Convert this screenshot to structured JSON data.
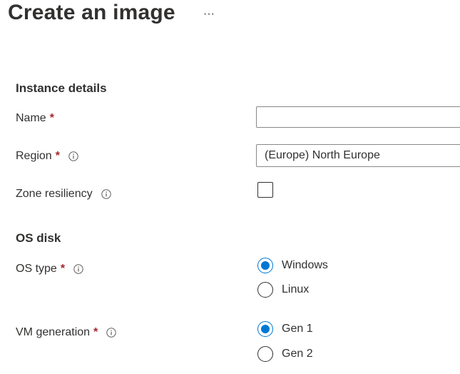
{
  "header": {
    "title": "Create an image",
    "more_label": "···"
  },
  "sections": {
    "instance_details": "Instance details",
    "os_disk": "OS disk"
  },
  "fields": {
    "name": {
      "label": "Name",
      "required": "*",
      "value": "",
      "placeholder": ""
    },
    "region": {
      "label": "Region",
      "required": "*",
      "value": "(Europe) North Europe"
    },
    "zone_resiliency": {
      "label": "Zone resiliency",
      "checked": false
    },
    "os_type": {
      "label": "OS type",
      "required": "*",
      "options": [
        "Windows",
        "Linux"
      ],
      "selected": "Windows"
    },
    "vm_generation": {
      "label": "VM generation",
      "required": "*",
      "options": [
        "Gen 1",
        "Gen 2"
      ],
      "selected": "Gen 1"
    }
  },
  "icons": {
    "info": "info-icon",
    "more": "ellipsis-icon"
  },
  "colors": {
    "accent": "#0078d4",
    "required": "#a4262c",
    "text": "#323130",
    "border": "#8a8886"
  }
}
